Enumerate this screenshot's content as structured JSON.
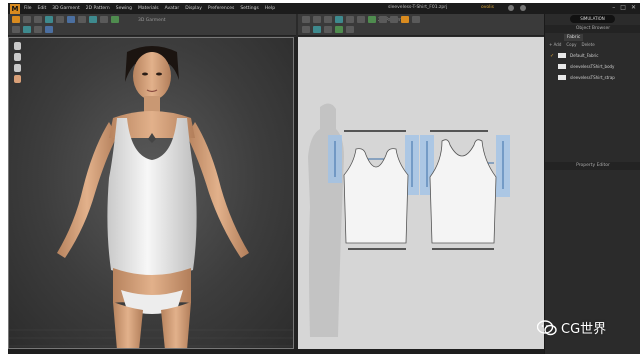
{
  "app": {
    "logo": "M",
    "window_title": "sleeveless-T-Shirt_F01.zprj",
    "user": "ovolis"
  },
  "menubar": {
    "items": [
      "File",
      "Edit",
      "3D Garment",
      "2D Pattern",
      "Sewing",
      "Materials",
      "Avatar",
      "Display",
      "Preferences",
      "Settings",
      "Help"
    ]
  },
  "toolbar_3d": {
    "caption": "3D Garment"
  },
  "toolbar_2d": {
    "caption": "2D Pattern"
  },
  "right_panel": {
    "simulation_label": "SIMULATION",
    "browser_title": "Object Browser",
    "tab_label": "Fabric",
    "tools": [
      "+ Add",
      "Copy",
      "Delete"
    ],
    "fabrics": [
      {
        "name": "Default_Fabric",
        "selected": true
      },
      {
        "name": "sleevelessTShirt_body",
        "selected": false
      },
      {
        "name": "sleevelessTShirt_strap",
        "selected": false
      }
    ],
    "property_title": "Property Editor"
  },
  "watermark": {
    "text": "CG世界"
  },
  "colors": {
    "accent": "#d98b1f",
    "pattern_fill": "#f4f4f4",
    "seam_highlight": "#9ec2e8",
    "viewport_bg": "#4a4a4a"
  }
}
